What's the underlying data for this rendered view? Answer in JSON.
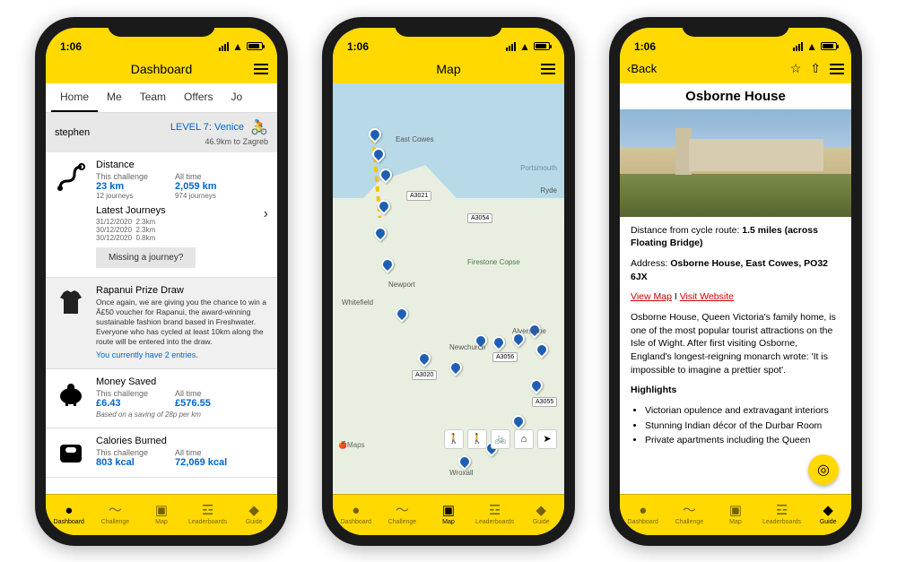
{
  "status_bar": {
    "time": "1:06"
  },
  "bottom_nav": {
    "dashboard": "Dashboard",
    "challenge": "Challenge",
    "map": "Map",
    "leaderboards": "Leaderboards",
    "guide": "Guide"
  },
  "phone1": {
    "title": "Dashboard",
    "tabs": {
      "home": "Home",
      "me": "Me",
      "team": "Team",
      "offers": "Offers",
      "journeys": "Jo"
    },
    "user": {
      "name": "stephen",
      "level": "LEVEL 7: Venice",
      "progress": "46.9km to Zagreb"
    },
    "distance": {
      "heading": "Distance",
      "this_label": "This challenge",
      "this_val": "23 km",
      "this_sub": "12 journeys",
      "all_label": "All time",
      "all_val": "2,059 km",
      "all_sub": "974 journeys"
    },
    "latest": {
      "heading": "Latest Journeys",
      "rows": [
        {
          "date": "31/12/2020",
          "dist": "2.3km"
        },
        {
          "date": "30/12/2020",
          "dist": "2.3km"
        },
        {
          "date": "30/12/2020",
          "dist": "0.8km"
        }
      ],
      "missing_btn": "Missing a journey?"
    },
    "prize": {
      "heading": "Rapanui Prize Draw",
      "desc": "Once again, we are giving you the chance to win a Â£50 voucher for Rapanui, the award-winning sustainable fashion brand based in Freshwater. Everyone who has cycled at least 10km along the route will be entered into the draw.",
      "entries": "You currently have 2 entries."
    },
    "money": {
      "heading": "Money Saved",
      "this_label": "This challenge",
      "this_val": "£6.43",
      "all_label": "All time",
      "all_val": "£576.55",
      "note": "Based on a saving of 28p per km"
    },
    "calories": {
      "heading": "Calories Burned",
      "this_label": "This challenge",
      "this_val": "803 kcal",
      "all_label": "All time",
      "all_val": "72,069 kcal"
    }
  },
  "phone2": {
    "title": "Map",
    "roads": {
      "a3021": "A3021",
      "a3054": "A3054",
      "a3020": "A3020",
      "a3056": "A3056",
      "a3055": "A3055"
    },
    "places": {
      "east_cowes": "East Cowes",
      "ryde": "Ryde",
      "newport": "Newport",
      "whitefield": "Whitefield",
      "firestone": "Firestone Copse",
      "newchurch": "Newchurch",
      "alverstone": "Alverstone",
      "wroxall": "Wroxall",
      "portsmouth": "Portsmouth"
    },
    "attrib": "🍎Maps"
  },
  "phone3": {
    "back": "Back",
    "title": "Osborne House",
    "distance_label": "Distance from cycle route: ",
    "distance_val": "1.5 miles (across Floating Bridge)",
    "address_label": "Address: ",
    "address_val": "Osborne House, East Cowes, PO32 6JX",
    "view_map": "View Map",
    "visit_site": "Visit Website",
    "desc": "Osborne House, Queen Victoria's family home, is one of the most popular tourist attractions on the Isle of Wight. After first visiting Osborne, England's longest-reigning monarch wrote: 'It is impossible to imagine a prettier spot'.",
    "highlights_heading": "Highlights",
    "highlights": [
      "Victorian opulence and extravagant interiors",
      "Stunning Indian décor of the Durbar Room",
      "Private apartments including the Queen"
    ]
  }
}
